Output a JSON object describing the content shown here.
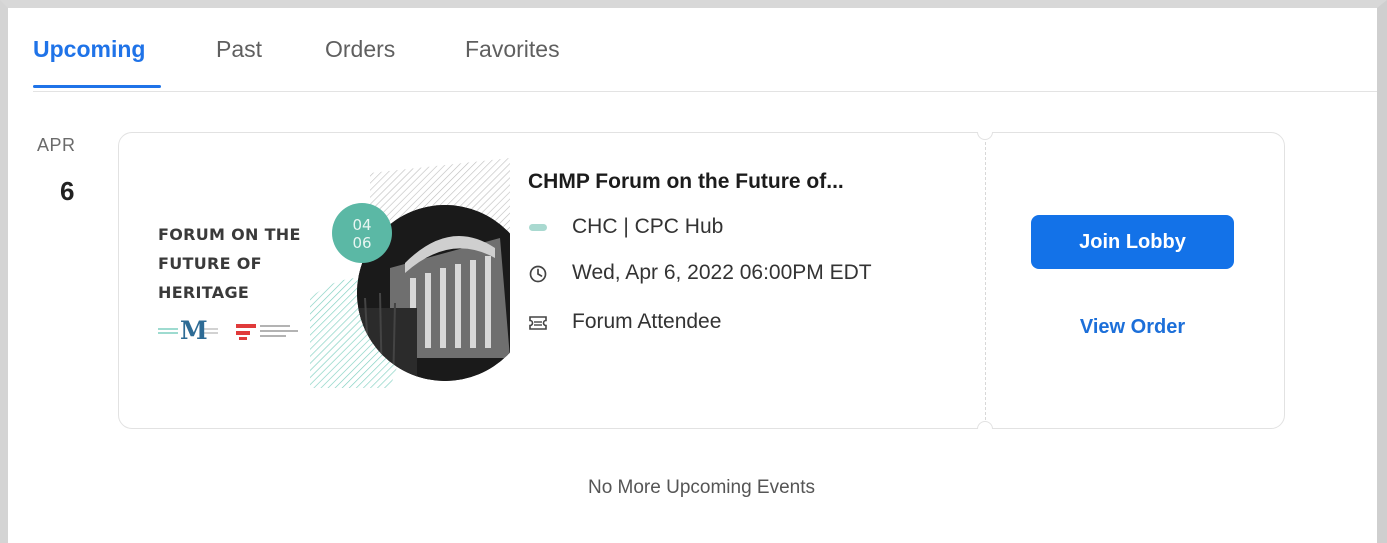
{
  "tabs": [
    {
      "label": "Upcoming",
      "active": true
    },
    {
      "label": "Past",
      "active": false
    },
    {
      "label": "Orders",
      "active": false
    },
    {
      "label": "Favorites",
      "active": false
    }
  ],
  "event": {
    "month": "APR",
    "day": "6",
    "poster": {
      "title_lines": [
        "FORUM ON THE",
        "FUTURE OF",
        "HERITAGE"
      ],
      "date_badge_top": "04",
      "date_badge_bottom": "06",
      "logo_letter": "M"
    },
    "title": "CHMP Forum on the Future of...",
    "host": "CHC | CPC Hub",
    "datetime": "Wed, Apr 6, 2022 06:00PM EDT",
    "ticket": "Forum Attendee",
    "join_label": "Join Lobby",
    "view_order_label": "View Order"
  },
  "empty_message": "No More Upcoming Events",
  "colors": {
    "accent": "#1f73e8",
    "button": "#1372e8",
    "badge_teal": "#5bb8a5"
  },
  "icons": {
    "host": "host-pill-icon",
    "time": "clock-icon",
    "ticket": "ticket-icon"
  }
}
